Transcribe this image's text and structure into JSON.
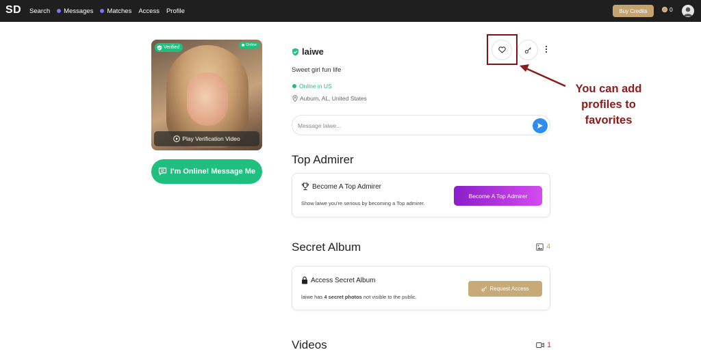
{
  "nav": {
    "logo": "SD",
    "links": [
      {
        "label": "Search",
        "dot": false
      },
      {
        "label": "Messages",
        "dot": true
      },
      {
        "label": "Matches",
        "dot": true
      },
      {
        "label": "Access",
        "dot": false
      },
      {
        "label": "Profile",
        "dot": false
      }
    ],
    "buy_credits": "Buy Credits",
    "credits_count": "0"
  },
  "profile": {
    "verified_badge": "Verified",
    "online_badge": "Online",
    "play_video": "Play Verification Video",
    "message_me": "I'm Online! Message Me",
    "username": "laiwe",
    "tagline": "Sweet girl fun life",
    "online_status": "Online in US",
    "location": "Auburn, AL, United States",
    "message_placeholder": "Message laiwe..."
  },
  "annotation": {
    "line1": "You can add",
    "line2": "profiles to",
    "line3": "favorites"
  },
  "top_admirer": {
    "section_title": "Top Admirer",
    "heading": "Become A Top Admirer",
    "description": "Show laiwe you're serious by becoming a Top admirer.",
    "button": "Become A Top Admirer"
  },
  "secret_album": {
    "section_title": "Secret Album",
    "count": "4",
    "heading": "Access Secret Album",
    "description_prefix": "laiwe has ",
    "description_count": "4 secret photos",
    "description_suffix": " not visible to the public.",
    "button": "Request Access"
  },
  "videos": {
    "section_title": "Videos",
    "count": "1"
  },
  "colors": {
    "navbar": "#1f1f1f",
    "accent_green": "#1fbf80",
    "gold": "#c4a36e",
    "send_blue": "#2d8ef0",
    "admirer_purple": "#8b1ec9",
    "annotation_red": "#8b1a1a"
  },
  "icons": [
    "shield-check-icon",
    "play-circle-icon",
    "chat-bubble-icon",
    "heart-icon",
    "key-icon",
    "more-vertical-icon",
    "send-icon",
    "map-pin-icon",
    "trophy-icon",
    "lock-icon",
    "image-icon",
    "video-icon",
    "coin-icon",
    "user-avatar-icon"
  ]
}
